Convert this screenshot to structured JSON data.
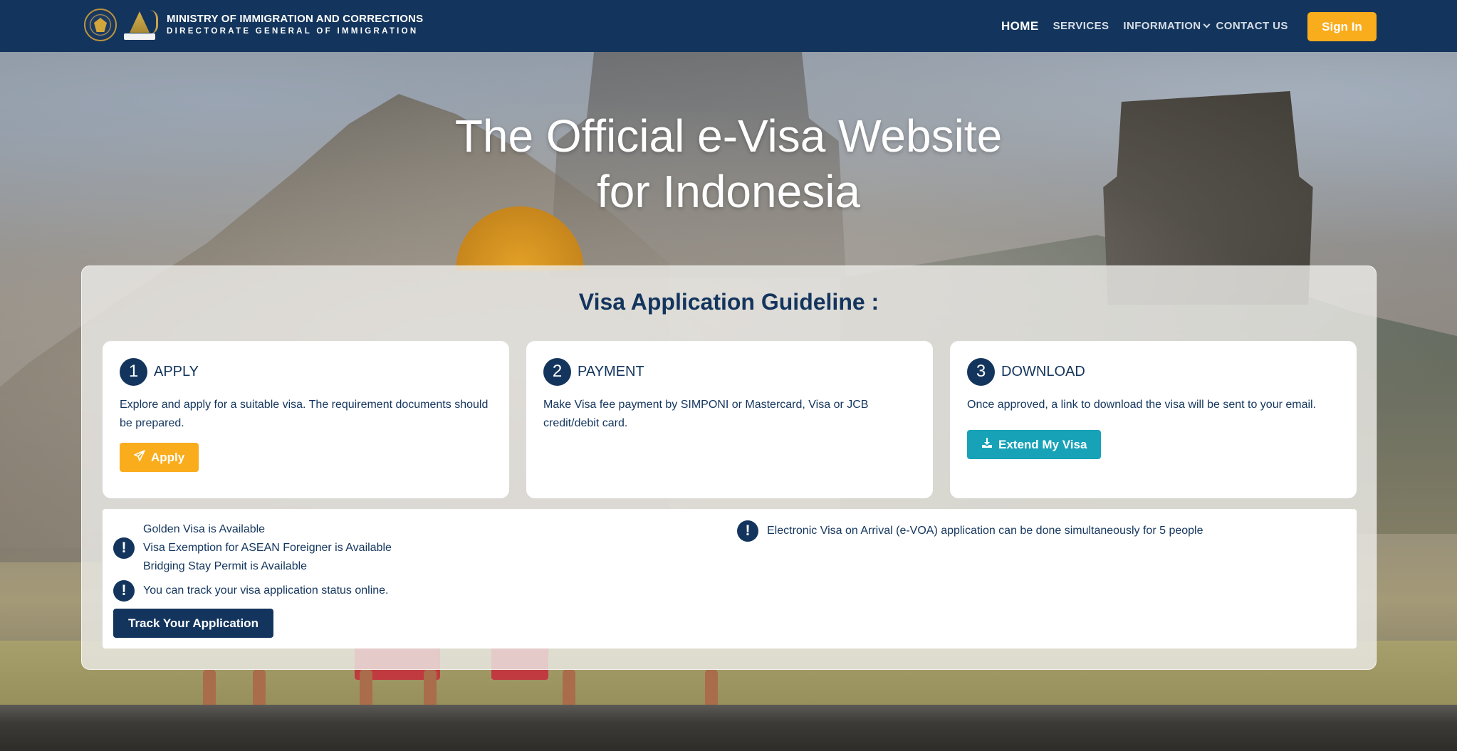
{
  "header": {
    "brand_title": "MINISTRY OF IMMIGRATION AND CORRECTIONS",
    "brand_subtitle": "DIRECTORATE GENERAL OF IMMIGRATION",
    "nav": [
      {
        "label": "HOME",
        "active": true
      },
      {
        "label": "SERVICES"
      },
      {
        "label": "INFORMATION",
        "has_dropdown": true
      },
      {
        "label": "CONTACT US"
      }
    ],
    "signin_label": "Sign In"
  },
  "hero": {
    "title_line1": "The Official e-Visa Website",
    "title_line2": "for Indonesia"
  },
  "guideline": {
    "title": "Visa Application Guideline :",
    "steps": [
      {
        "number": "1",
        "title": "APPLY",
        "description": "Explore and apply for a suitable visa. The requirement documents should be prepared.",
        "button_label": "Apply",
        "button_icon": "paper-plane-icon"
      },
      {
        "number": "2",
        "title": "PAYMENT",
        "description": "Make Visa fee payment by SIMPONI or Mastercard, Visa or JCB credit/debit card."
      },
      {
        "number": "3",
        "title": "DOWNLOAD",
        "description": "Once approved, a link to download the visa will be sent to your email.",
        "button_label": "Extend My Visa",
        "button_icon": "download-icon"
      }
    ]
  },
  "info": {
    "icon": "exclamation-icon",
    "availability": [
      "Golden Visa is Available",
      "Visa Exemption for ASEAN Foreigner is Available",
      "Bridging Stay Permit is Available"
    ],
    "tracking_note": "You can track your visa application status online.",
    "track_button_label": "Track Your Application",
    "evoa_note": "Electronic Visa on Arrival (e-VOA) application can be done simultaneously for 5 people",
    "alert_glyph": "!"
  },
  "colors": {
    "navy": "#13355d",
    "accent_yellow": "#f9ac1c",
    "accent_teal": "#17a2b8",
    "white": "#ffffff"
  }
}
